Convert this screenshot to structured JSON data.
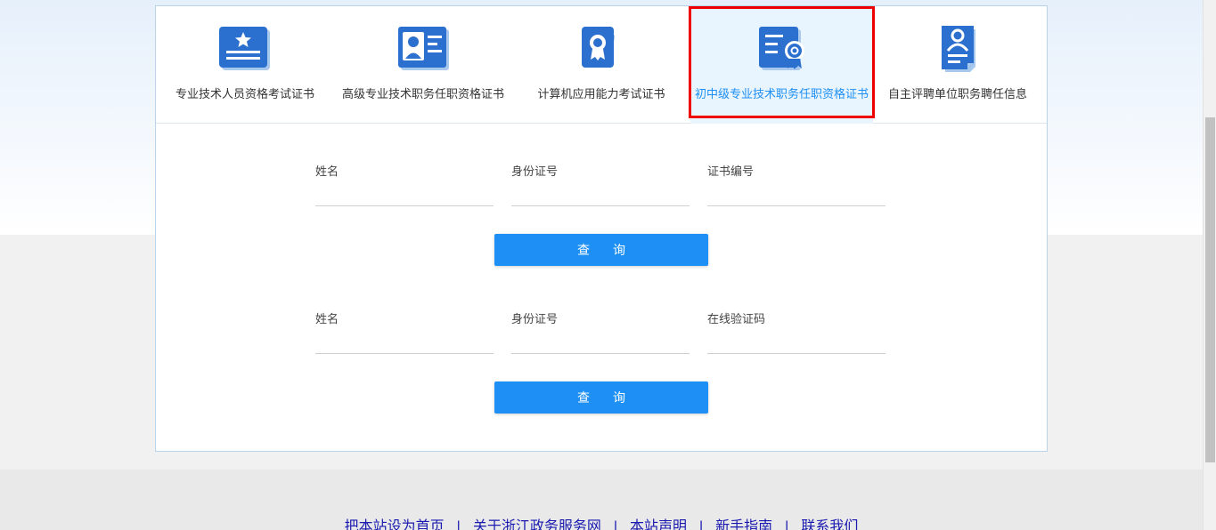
{
  "tabs": [
    {
      "label": "专业技术人员资格考试证书",
      "icon": "certificate-star-icon",
      "active": false
    },
    {
      "label": "高级专业技术职务任职资格证书",
      "icon": "id-card-icon",
      "active": false
    },
    {
      "label": "计算机应用能力考试证书",
      "icon": "badge-cards-icon",
      "active": false
    },
    {
      "label": "初中级专业技术职务任职资格证书",
      "icon": "document-seal-icon",
      "active": true
    },
    {
      "label": "自主评聘单位职务聘任信息",
      "icon": "person-document-icon",
      "active": false
    }
  ],
  "form1": {
    "name_label": "姓名",
    "id_label": "身份证号",
    "cert_label": "证书编号",
    "name_value": "",
    "id_value": "",
    "cert_value": "",
    "button": "查询"
  },
  "form2": {
    "name_label": "姓名",
    "id_label": "身份证号",
    "code_label": "在线验证码",
    "name_value": "",
    "id_value": "",
    "code_value": "",
    "button": "查询"
  },
  "footer": {
    "links": [
      "把本站设为首页",
      "关于浙江政务服务网",
      "本站声明",
      "新手指南",
      "联系我们"
    ],
    "separator": "|"
  },
  "colors": {
    "accent": "#1e90f5",
    "icon_blue": "#2b6fcf",
    "highlight": "#ee0000",
    "active_bg": "#e8f4fe",
    "footer_link": "#1a1ab0"
  }
}
